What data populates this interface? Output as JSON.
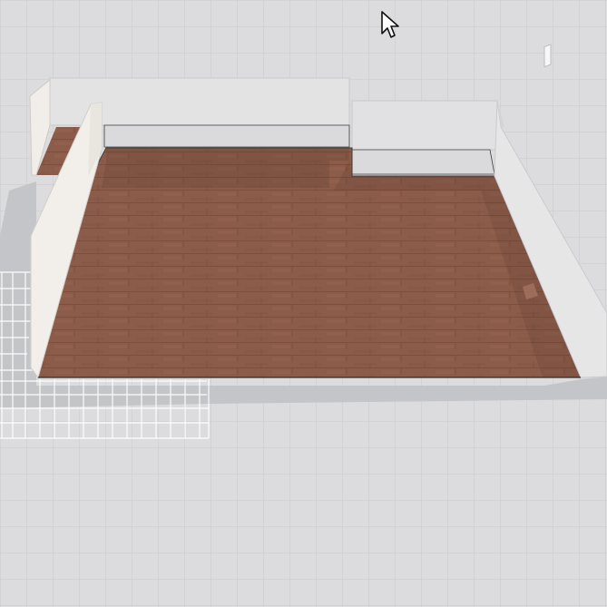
{
  "viewport": {
    "name": "3d-floor-plan-viewport"
  },
  "colors": {
    "ground": "#dcdcde",
    "ground_grid": "#c7c8cb",
    "wall_face": "#e6e6e7",
    "wall_face_dark": "#d6d6d8",
    "wall_side": "#f1eee9",
    "wall_top": "#cfcfd1",
    "floor": "#8c5c4a",
    "floor_line": "#7d4f3f",
    "shadow": "#b9babd",
    "selection_grid": "#ffffff",
    "cursor_fill": "#ffffff",
    "cursor_stroke": "#111111"
  },
  "icons": {
    "cursor": "arrow-pointer-icon"
  }
}
